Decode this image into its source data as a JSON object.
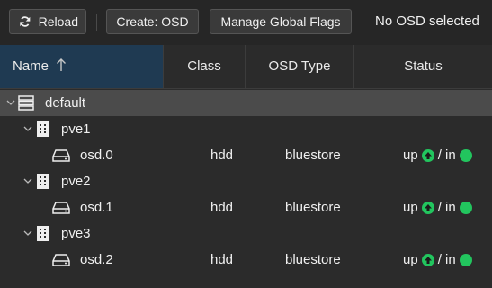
{
  "toolbar": {
    "reload_label": "Reload",
    "create_label": "Create: OSD",
    "flags_label": "Manage Global Flags",
    "selection_text": "No OSD selected"
  },
  "columns": {
    "name": "Name",
    "class": "Class",
    "osd_type": "OSD Type",
    "status": "Status"
  },
  "tree": {
    "root": {
      "label": "default"
    },
    "hosts": [
      {
        "label": "pve1",
        "osd": {
          "name": "osd.0",
          "class": "hdd",
          "type": "bluestore",
          "up": "up",
          "sep": "/ in"
        }
      },
      {
        "label": "pve2",
        "osd": {
          "name": "osd.1",
          "class": "hdd",
          "type": "bluestore",
          "up": "up",
          "sep": "/ in"
        }
      },
      {
        "label": "pve3",
        "osd": {
          "name": "osd.2",
          "class": "hdd",
          "type": "bluestore",
          "up": "up",
          "sep": "/ in"
        }
      }
    ]
  },
  "colors": {
    "status_green": "#22c55e",
    "header_selected": "#1f3a52",
    "root_row": "#4b4b4b"
  }
}
